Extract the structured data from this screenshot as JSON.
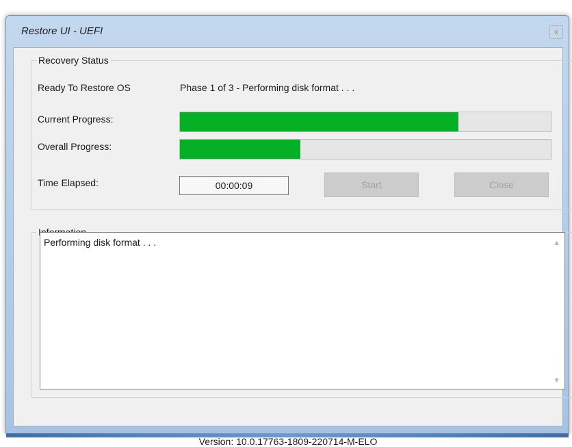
{
  "window": {
    "title": "Restore UI - UEFI",
    "close_glyph": "x"
  },
  "recovery_status": {
    "group_label": "Recovery Status",
    "state_label": "Ready To Restore OS",
    "phase_text": "Phase 1 of 3 - Performing disk format . . .",
    "current_progress_label": "Current Progress:",
    "current_progress_fraction": 0.75,
    "overall_progress_label": "Overall Progress:",
    "overall_progress_fraction": 0.325,
    "time_elapsed_label": "Time Elapsed:",
    "time_elapsed_value": "00:00:09",
    "start_button": {
      "label": "Start",
      "enabled": false
    },
    "close_button": {
      "label": "Close",
      "enabled": false
    }
  },
  "information": {
    "group_label": "Information",
    "text": "Performing disk format . . ."
  },
  "footer": {
    "version": "Version: 10.0.17763-1809-220714-M-ELO"
  },
  "colors": {
    "progress_fill": "#06b025",
    "progress_track": "#e6e6e6"
  }
}
